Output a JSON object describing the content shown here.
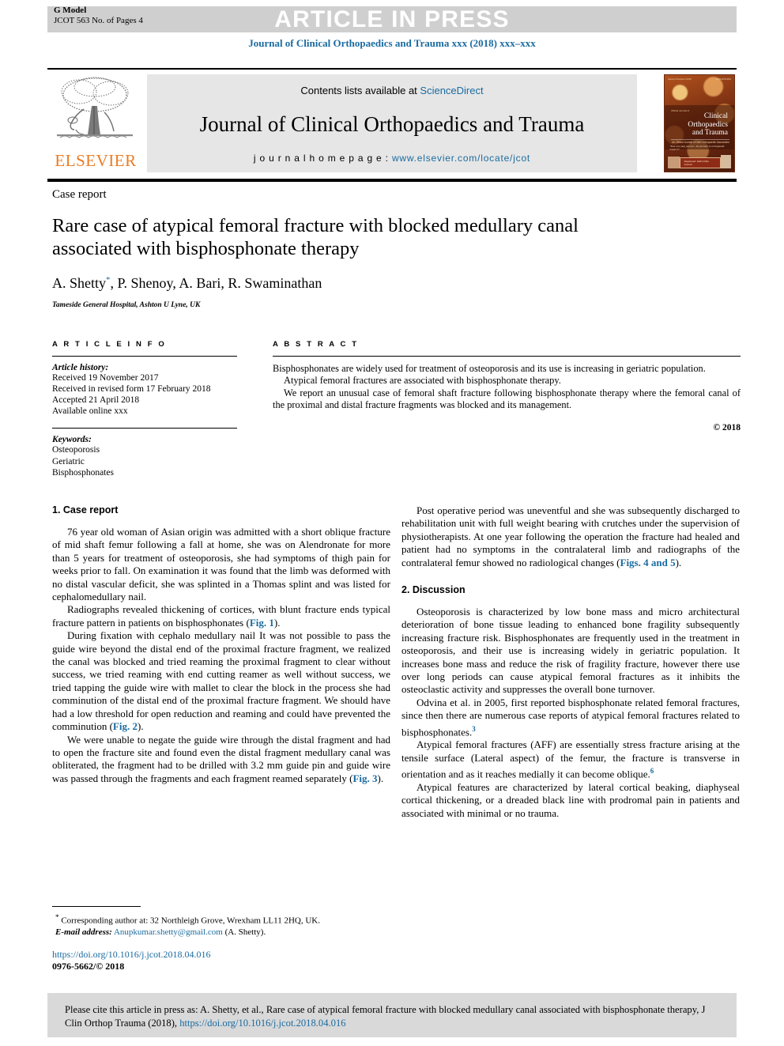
{
  "header": {
    "g_model": "G Model",
    "g_model_sub": "JCOT 563 No. of Pages 4",
    "press_banner": "ARTICLE IN PRESS",
    "running_head": "Journal of Clinical Orthopaedics and Trauma xxx (2018) xxx–xxx"
  },
  "masthead": {
    "contents_prefix": "Contents lists available at ",
    "sciencedirect": "ScienceDirect",
    "journal_title": "Journal of Clinical Orthopaedics and Trauma",
    "homepage_label": "j o u r n a l   h o m e p a g e :  ",
    "homepage_url": "www.elsevier.com/locate/jcot",
    "publisher_name": "ELSEVIER",
    "publisher_accent": "#eb7c22",
    "link_color": "#1a6ba0",
    "cover": {
      "top_left": "Volume 9 Number 2 2018",
      "top_right": "ISSN 0976-5662",
      "kicker": "Official Journal of",
      "title_line1": "Clinical Orthopaedics",
      "title_line2": "and Trauma",
      "subtitle": "An Official Journal of Delhi Orthopaedic Association",
      "quote": "\"Your one stop journal - the premier in orthopaedic research\"",
      "pill": "Registered: Delhi Ortho Journal"
    }
  },
  "article": {
    "kicker": "Case report",
    "title": "Rare case of atypical femoral fracture with blocked medullary canal associated with bisphosphonate therapy",
    "authors_plain": "A. Shetty, P. Shenoy, A. Bari, R. Swaminathan",
    "author_1": "A. Shetty",
    "authors_rest": ", P. Shenoy, A. Bari, R. Swaminathan",
    "corresponding_mark": "*",
    "affiliation": "Tameside General Hospital, Ashton U Lyne, UK"
  },
  "article_info": {
    "heading": "A R T I C L E   I N F O",
    "history_label": "Article history:",
    "history": [
      "Received 19 November 2017",
      "Received in revised form 17 February 2018",
      "Accepted 21 April 2018",
      "Available online xxx"
    ],
    "keywords_label": "Keywords:",
    "keywords": [
      "Osteoporosis",
      "Geriatric",
      "Bisphosphonates"
    ]
  },
  "abstract": {
    "heading": "A B S T R A C T",
    "paragraphs": [
      "Bisphosphonates are widely used for treatment of osteoporosis and its use is increasing in geriatric population.",
      "Atypical femoral fractures are associated with bisphosphonate therapy.",
      "We report an unusual case of femoral shaft fracture following bisphosphonate therapy where the femoral canal of the proximal and distal fracture fragments was blocked and its management."
    ],
    "copyright": "© 2018"
  },
  "sections": {
    "case_report_heading": "1. Case report",
    "discussion_heading": "2. Discussion",
    "case_p1": "76 year old woman of Asian origin was admitted with a short oblique fracture of mid shaft femur following a fall at home, she was on Alendronate for more than 5 years for treatment of osteoporosis, she had symptoms of thigh pain for weeks prior to fall. On examination it was found that the limb was deformed with no distal vascular deficit, she was splinted in a Thomas splint and was listed for cephalomedullary nail.",
    "case_p2_a": "Radiographs revealed thickening of cortices, with blunt fracture ends typical fracture pattern in patients on bisphosphonates (",
    "case_p2_fig": "Fig. 1",
    "case_p2_b": ").",
    "case_p3_a": "During fixation with cephalo medullary nail It was not possible to pass the guide wire beyond the distal end of the proximal fracture fragment, we realized the canal was blocked and tried reaming the proximal fragment to clear without success, we tried reaming with end cutting reamer as well without success, we tried tapping the guide wire with mallet to clear the block in the process she had comminution of the distal end of the proximal fracture fragment. We should have had a low threshold for open reduction and reaming and could have prevented the comminution (",
    "case_p3_fig": "Fig. 2",
    "case_p3_b": ").",
    "case_p4_a": "We were unable to negate the guide wire through the distal fragment and had to open the fracture site and found even the distal fragment medullary canal was obliterated, the fragment had to be drilled with 3.2 mm guide pin and guide wire was passed through the fragments and each fragment reamed separately (",
    "case_p4_fig": "Fig. 3",
    "case_p4_b": ").",
    "right_p1_a": "Post operative period was uneventful and she was subsequently discharged to rehabilitation unit with full weight bearing with crutches under the supervision of physiotherapists. At one year following the operation the fracture had healed and patient had no symptoms in the contralateral limb and radiographs of the contralateral femur showed no radiological changes (",
    "right_p1_fig": "Figs. 4 and 5",
    "right_p1_b": ").",
    "disc_p1": "Osteoporosis is characterized by low bone mass and micro architectural deterioration of bone tissue leading to enhanced bone fragility subsequently increasing fracture risk. Bisphosphonates are frequently used in the treatment in osteoporosis, and their use is increasing widely in geriatric population. It increases bone mass and reduce the risk of fragility fracture, however there use over long periods can cause atypical femoral fractures as it inhibits the osteoclastic activity and suppresses the overall bone turnover.",
    "disc_p2_a": "Odvina et al. in 2005, first reported bisphosphonate related femoral fractures, since then there are numerous case reports of atypical femoral fractures related to bisphosphonates.",
    "disc_p2_ref": "3",
    "disc_p3_a": "Atypical femoral fractures (AFF) are essentially stress fracture arising at the tensile surface (Lateral aspect) of the femur, the fracture is transverse in orientation and as it reaches medially it can become oblique.",
    "disc_p3_ref": "6",
    "disc_p4": "Atypical features are characterized by lateral cortical beaking, diaphyseal cortical thickening, or a dreaded black line with prodromal pain in patients and associated with minimal or no trauma."
  },
  "footnote": {
    "marker": "*",
    "corresponding": "Corresponding author at: 32 Northleigh Grove, Wrexham LL11 2HQ, UK.",
    "email_label": "E-mail address:",
    "email": "Anupkumar.shetty@gmail.com",
    "email_owner": "(A. Shetty)."
  },
  "doi_block": {
    "doi": "https://doi.org/10.1016/j.jcot.2018.04.016",
    "issn": "0976-5662/© 2018"
  },
  "citation_footer": {
    "text_a": "Please cite this article in press as: A. Shetty, et al., Rare case of atypical femoral fracture with blocked medullary canal associated with bisphosphonate therapy, J Clin Orthop Trauma (2018), ",
    "doi_link": "https://doi.org/10.1016/j.jcot.2018.04.016"
  }
}
